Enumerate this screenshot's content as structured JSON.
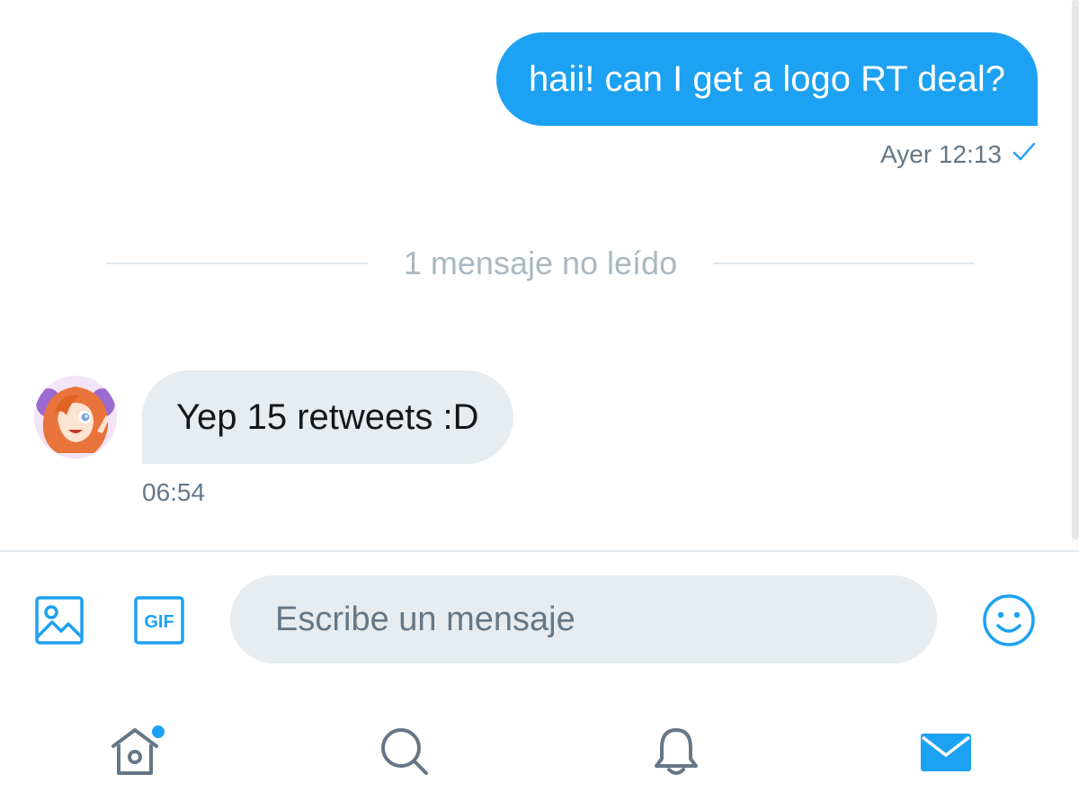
{
  "conversation": {
    "sent_message": {
      "text": "haii! can I get a logo RT deal?",
      "meta": "Ayer 12:13",
      "status_icon": "checkmark-icon"
    },
    "unread_divider": "1 mensaje no leído",
    "received_message": {
      "text": "Yep 15 retweets :D",
      "time": "06:54",
      "avatar": "anime-girl-avatar"
    }
  },
  "composer": {
    "placeholder": "Escribe un mensaje",
    "value": "",
    "gif_label": "GIF",
    "icons": [
      "image-icon",
      "gif-icon",
      "emoji-icon"
    ]
  },
  "tabbar": {
    "tabs": [
      {
        "name": "home",
        "icon": "home-icon",
        "has_badge": true
      },
      {
        "name": "search",
        "icon": "search-icon"
      },
      {
        "name": "notifications",
        "icon": "bell-icon"
      },
      {
        "name": "messages",
        "icon": "mail-icon",
        "active": true
      }
    ]
  },
  "colors": {
    "accent": "#1da1f2",
    "sent_bubble": "#1da1f2",
    "received_bubble": "#e6ecf0",
    "secondary_text": "#657786",
    "divider_text": "#aab8c2",
    "inactive_icon": "#657786"
  }
}
